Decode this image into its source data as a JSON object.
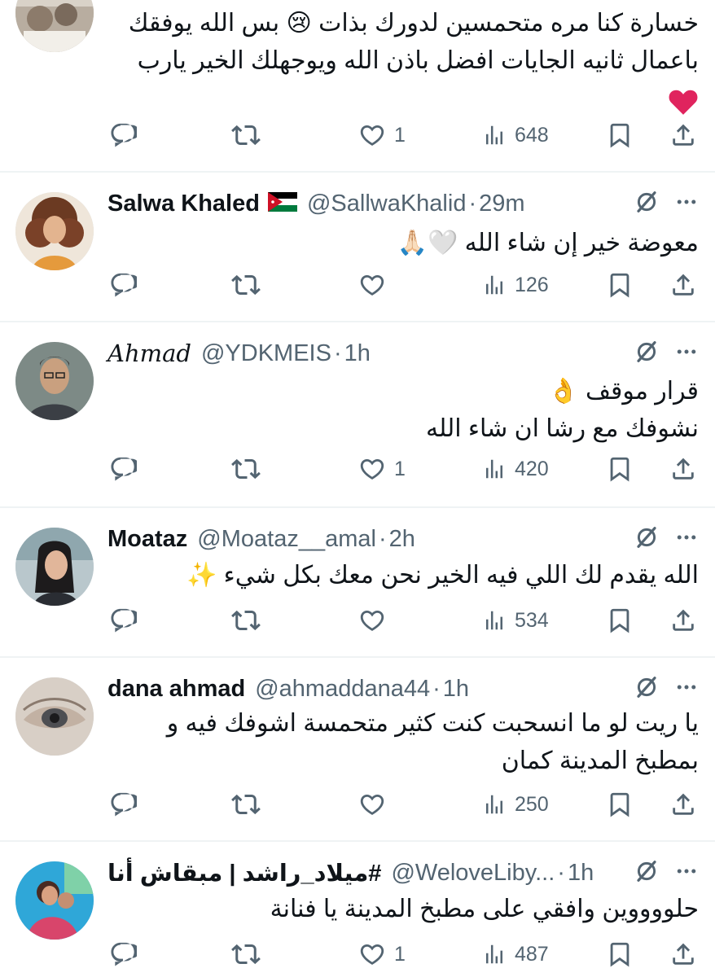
{
  "tweets": [
    {
      "name": "",
      "handle": "",
      "time": "",
      "lines": [
        "خسارة كنا مره متحمسين لدورك بذات 😢 بس الله يوفقك",
        "باعمال ثانيه الجايات افضل باذن الله ويوجهلك الخير يارب",
        "❤️"
      ],
      "likes": "1",
      "views": "648"
    },
    {
      "name": "Salwa Khaled",
      "handle": "@SallwaKhalid",
      "time": "29m",
      "lines": [
        "معوضة خير إن شاء الله 🤍🙏🏻"
      ],
      "likes": "",
      "views": "126"
    },
    {
      "name": "Ahmad",
      "handle": "@YDKMEIS",
      "time": "1h",
      "lines": [
        "قرار موقف 👌",
        "نشوفك مع رشا ان شاء الله"
      ],
      "likes": "1",
      "views": "420"
    },
    {
      "name": "Moataz",
      "handle": "@Moataz__amal",
      "time": "2h",
      "lines": [
        "الله يقدم لك اللي فيه الخير نحن معك بكل شيء ✨"
      ],
      "likes": "",
      "views": "534"
    },
    {
      "name": "dana ahmad",
      "handle": "@ahmaddana44",
      "time": "1h",
      "lines": [
        "يا ريت لو ما انسحبت كنت كثير متحمسة اشوفك فيه و",
        "بمطبخ المدينة كمان"
      ],
      "likes": "",
      "views": "250"
    },
    {
      "name": "#ميلاد_راشد | مبقاش أنا",
      "handle": "@WeloveLiby...",
      "time": "1h",
      "lines": [
        "حلووووين وافقي على مطبخ المدينة يا فنانة"
      ],
      "likes": "1",
      "views": "487"
    }
  ],
  "separator": "·",
  "icons": [
    "reply-icon",
    "retweet-icon",
    "like-icon",
    "views-icon",
    "bookmark-icon",
    "share-icon",
    "grok-icon",
    "more-icon"
  ],
  "colors": {
    "text": "#0f1419",
    "secondary": "#536471",
    "divider": "#eff3f4",
    "heart": "#e0245e"
  }
}
